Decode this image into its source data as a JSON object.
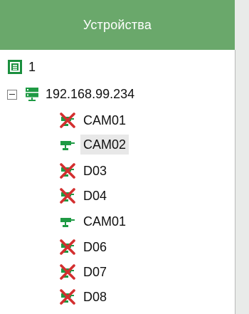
{
  "header": {
    "title": "Устройства"
  },
  "tree": {
    "root": {
      "label": "1",
      "icon": "device-group-icon"
    },
    "server": {
      "label": "192.168.99.234",
      "icon": "server-icon",
      "expanded": true
    },
    "cameras": [
      {
        "label": "CAM01",
        "status": "offline",
        "icon": "camera-offline-icon",
        "selected": false
      },
      {
        "label": "CAM02",
        "status": "online",
        "icon": "camera-online-icon",
        "selected": true
      },
      {
        "label": "D03",
        "status": "offline",
        "icon": "camera-offline-icon",
        "selected": false
      },
      {
        "label": "D04",
        "status": "offline",
        "icon": "camera-offline-icon",
        "selected": false
      },
      {
        "label": "CAM01",
        "status": "online",
        "icon": "camera-online-icon",
        "selected": false
      },
      {
        "label": "D06",
        "status": "offline",
        "icon": "camera-offline-icon",
        "selected": false
      },
      {
        "label": "D07",
        "status": "offline",
        "icon": "camera-offline-icon",
        "selected": false
      },
      {
        "label": "D08",
        "status": "offline",
        "icon": "camera-offline-icon",
        "selected": false
      }
    ]
  },
  "colors": {
    "header_bg": "#6aa86b",
    "online": "#1f9a44",
    "offline_red": "#d32f2f",
    "selected_bg": "#e8e8e8"
  }
}
